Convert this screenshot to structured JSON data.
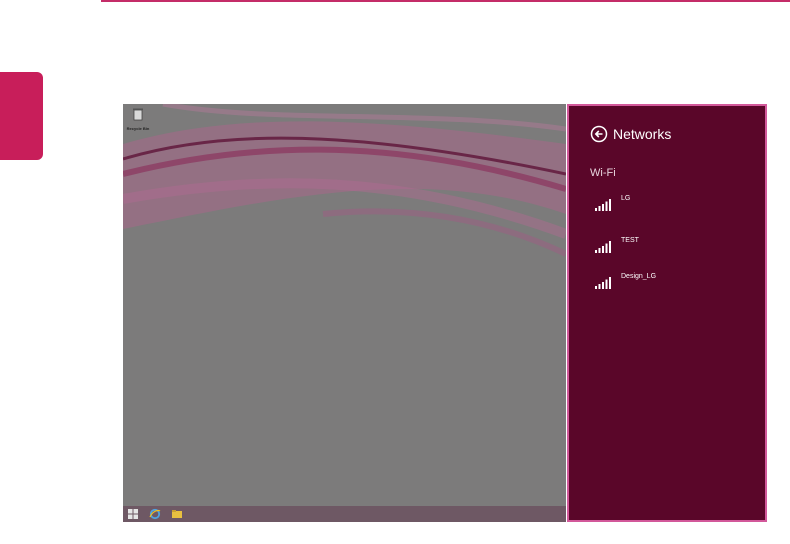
{
  "desktop": {
    "icon_label": "Recycle Bin"
  },
  "networks_pane": {
    "title": "Networks",
    "section": "Wi-Fi",
    "networks": [
      {
        "name": "LG"
      },
      {
        "name": "TEST"
      },
      {
        "name": "Design_LG"
      }
    ]
  },
  "colors": {
    "accent": "#c81e5a",
    "pane_background": "#5a0629",
    "pane_border": "#d2589a"
  },
  "icons": {
    "back": "back-arrow-circle-icon",
    "signal": "wifi-signal-bars-icon",
    "start": "windows-start-icon",
    "browser": "internet-explorer-icon",
    "explorer": "file-explorer-icon",
    "recycle": "recycle-bin-icon"
  }
}
